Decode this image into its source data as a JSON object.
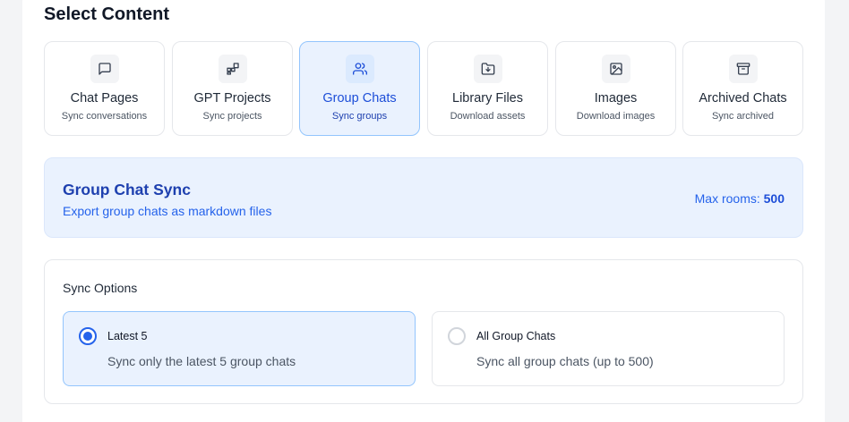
{
  "section_title": "Select Content",
  "content_types": [
    {
      "label": "Chat Pages",
      "sub": "Sync conversations",
      "icon": "message-square-icon",
      "selected": false
    },
    {
      "label": "GPT Projects",
      "sub": "Sync projects",
      "icon": "grid-blocks-icon",
      "selected": false
    },
    {
      "label": "Group Chats",
      "sub": "Sync groups",
      "icon": "users-icon",
      "selected": true
    },
    {
      "label": "Library Files",
      "sub": "Download assets",
      "icon": "folder-download-icon",
      "selected": false
    },
    {
      "label": "Images",
      "sub": "Download images",
      "icon": "image-icon",
      "selected": false
    },
    {
      "label": "Archived Chats",
      "sub": "Sync archived",
      "icon": "archive-icon",
      "selected": false
    }
  ],
  "info": {
    "title": "Group Chat Sync",
    "description": "Export group chats as markdown files",
    "max_label": "Max rooms:",
    "max_value": "500"
  },
  "sync_options": {
    "heading": "Sync Options",
    "options": [
      {
        "label": "Latest 5",
        "description": "Sync only the latest 5 group chats",
        "selected": true
      },
      {
        "label": "All Group Chats",
        "description": "Sync all group chats (up to 500)",
        "selected": false
      }
    ]
  },
  "colors": {
    "accent": "#2563eb",
    "selected_bg": "#eaf2fe",
    "selected_border": "#93c5fd"
  }
}
